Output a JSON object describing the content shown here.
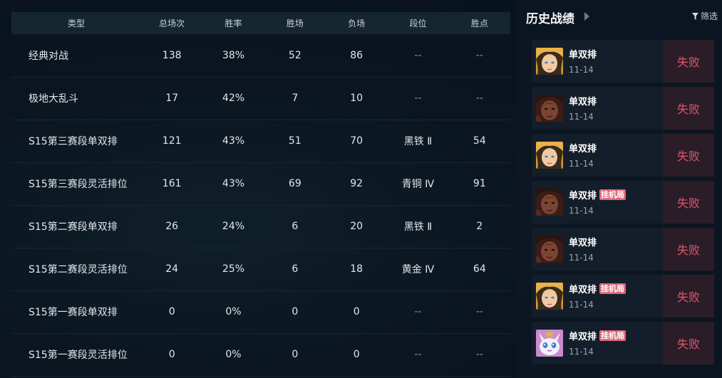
{
  "stats": {
    "headers": [
      "类型",
      "总场次",
      "胜率",
      "胜场",
      "负场",
      "段位",
      "胜点"
    ],
    "rows": [
      [
        "经典对战",
        "138",
        "38%",
        "52",
        "86",
        "--",
        "--"
      ],
      [
        "极地大乱斗",
        "17",
        "42%",
        "7",
        "10",
        "--",
        "--"
      ],
      [
        "S15第三赛段单双排",
        "121",
        "43%",
        "51",
        "70",
        "黑铁 Ⅱ",
        "54"
      ],
      [
        "S15第三赛段灵活排位",
        "161",
        "43%",
        "69",
        "92",
        "青铜 Ⅳ",
        "91"
      ],
      [
        "S15第二赛段单双排",
        "26",
        "24%",
        "6",
        "20",
        "黑铁 Ⅱ",
        "2"
      ],
      [
        "S15第二赛段灵活排位",
        "24",
        "25%",
        "6",
        "18",
        "黄金 Ⅳ",
        "64"
      ],
      [
        "S15第一赛段单双排",
        "0",
        "0%",
        "0",
        "0",
        "--",
        "--"
      ],
      [
        "S15第一赛段灵活排位",
        "0",
        "0%",
        "0",
        "0",
        "--",
        "--"
      ]
    ]
  },
  "history": {
    "title": "历史战绩",
    "filter_label": "筛选",
    "matches": [
      {
        "champion": "blonde",
        "mode": "单双排",
        "afk": "",
        "date": "11-14",
        "result": "失败"
      },
      {
        "champion": "dark",
        "mode": "单双排",
        "afk": "",
        "date": "11-14",
        "result": "失败"
      },
      {
        "champion": "blonde",
        "mode": "单双排",
        "afk": "",
        "date": "11-14",
        "result": "失败"
      },
      {
        "champion": "dark",
        "mode": "单双排",
        "afk": "挂机局",
        "date": "11-14",
        "result": "失败"
      },
      {
        "champion": "dark",
        "mode": "单双排",
        "afk": "",
        "date": "11-14",
        "result": "失败"
      },
      {
        "champion": "blonde",
        "mode": "单双排",
        "afk": "挂机局",
        "date": "11-14",
        "result": "失败"
      },
      {
        "champion": "yuumi",
        "mode": "单双排",
        "afk": "挂机局",
        "date": "11-14",
        "result": "失败"
      }
    ]
  },
  "colors": {
    "loss": "#e0566b",
    "afk_tag": "#e0677a",
    "header_bg": "#152630"
  }
}
